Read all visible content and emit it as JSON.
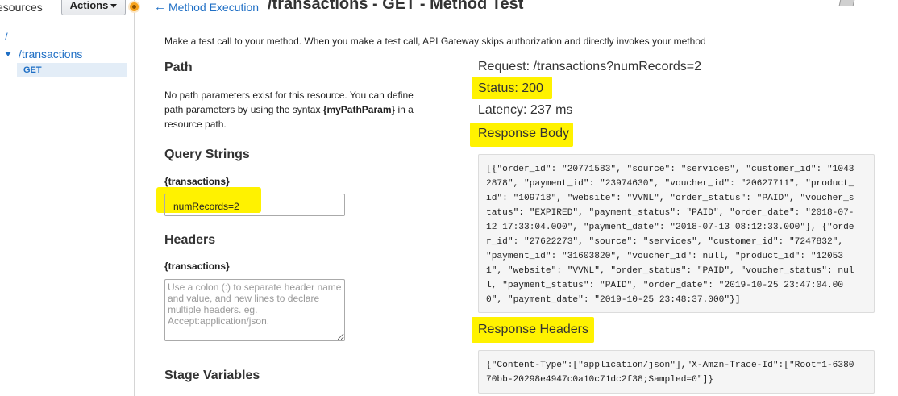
{
  "sidebar": {
    "resources_label": "esources",
    "actions_label": "Actions",
    "tree": {
      "root": "/",
      "resource": "/transactions",
      "method": "GET"
    }
  },
  "header": {
    "back_link": "Method Execution",
    "title": "/transactions - GET - Method Test"
  },
  "intro": "Make a test call to your method. When you make a test call, API Gateway skips authorization and directly invokes your method",
  "form": {
    "path": {
      "heading": "Path",
      "desc_before": "No path parameters exist for this resource. You can define path parameters by using the syntax ",
      "syntax": "{myPathParam}",
      "desc_after": " in a resource path."
    },
    "query_strings": {
      "heading": "Query Strings",
      "label": "{transactions}",
      "value": "numRecords=2"
    },
    "headers": {
      "heading": "Headers",
      "label": "{transactions}",
      "placeholder": "Use a colon (:) to separate header name and value, and new lines to declare multiple headers. eg. Accept:application/json."
    },
    "stage_variables": {
      "heading": "Stage Variables"
    }
  },
  "result": {
    "request": "Request: /transactions?numRecords=2",
    "status": "Status: 200",
    "latency": "Latency: 237 ms",
    "response_body_heading": "Response Body",
    "response_body": "[{\"order_id\": \"20771583\", \"source\": \"services\", \"customer_id\": \"1043\n2878\", \"payment_id\": \"23974630\", \"voucher_id\": \"20627711\", \"product_\nid\": \"109718\", \"website\": \"VVNL\", \"order_status\": \"PAID\", \"voucher_s\ntatus\": \"EXPIRED\", \"payment_status\": \"PAID\", \"order_date\": \"2018-07-\n12 17:33:04.000\", \"payment_date\": \"2018-07-13 08:12:33.000\"}, {\"orde\nr_id\": \"27622273\", \"source\": \"services\", \"customer_id\": \"7247832\",\n\"payment_id\": \"31603820\", \"voucher_id\": null, \"product_id\": \"12053\n1\", \"website\": \"VVNL\", \"order_status\": \"PAID\", \"voucher_status\": nul\nl, \"payment_status\": \"PAID\", \"order_date\": \"2019-10-25 23:47:04.00\n0\", \"payment_date\": \"2019-10-25 23:48:37.000\"}]",
    "response_headers_heading": "Response Headers",
    "response_headers": "{\"Content-Type\":[\"application/json\"],\"X-Amzn-Trace-Id\":[\"Root=1-6380\n70bb-20298e4947c0a10c71dc2f38;Sampled=0\"]}"
  },
  "colors": {
    "link": "#1f6fc5",
    "highlight": "#fff200",
    "accent_dot": "#f7a21b"
  }
}
